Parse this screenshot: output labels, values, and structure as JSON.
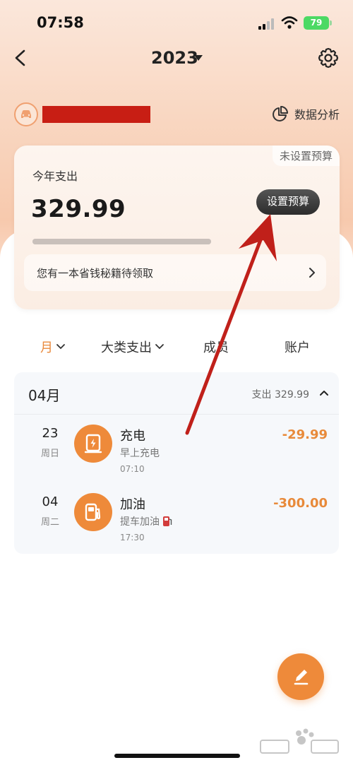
{
  "status_bar": {
    "time": "07:58",
    "battery": "79"
  },
  "nav": {
    "year": "2023"
  },
  "account": {
    "analysis_label": "数据分析"
  },
  "summary": {
    "no_budget_tag": "未设置预算",
    "label": "今年支出",
    "amount": "329.99",
    "budget_button": "设置预算",
    "promo_text": "您有一本省钱秘籍待领取"
  },
  "tabs": [
    {
      "label": "月"
    },
    {
      "label": "大类支出"
    },
    {
      "label": "成员"
    },
    {
      "label": "账户"
    }
  ],
  "group": {
    "month": "04月",
    "total": "支出 329.99",
    "rows": [
      {
        "day": "23",
        "weekday": "周日",
        "title": "充电",
        "note": "早上充电",
        "time": "07:10",
        "amount": "-29.99",
        "icon": "charging-station-icon"
      },
      {
        "day": "04",
        "weekday": "周二",
        "title": "加油",
        "note": "提车加油",
        "time": "17:30",
        "amount": "-300.00",
        "icon": "fuel-pump-icon"
      }
    ]
  },
  "colors": {
    "accent": "#ee8a3a",
    "annotation": "#c0201a"
  }
}
